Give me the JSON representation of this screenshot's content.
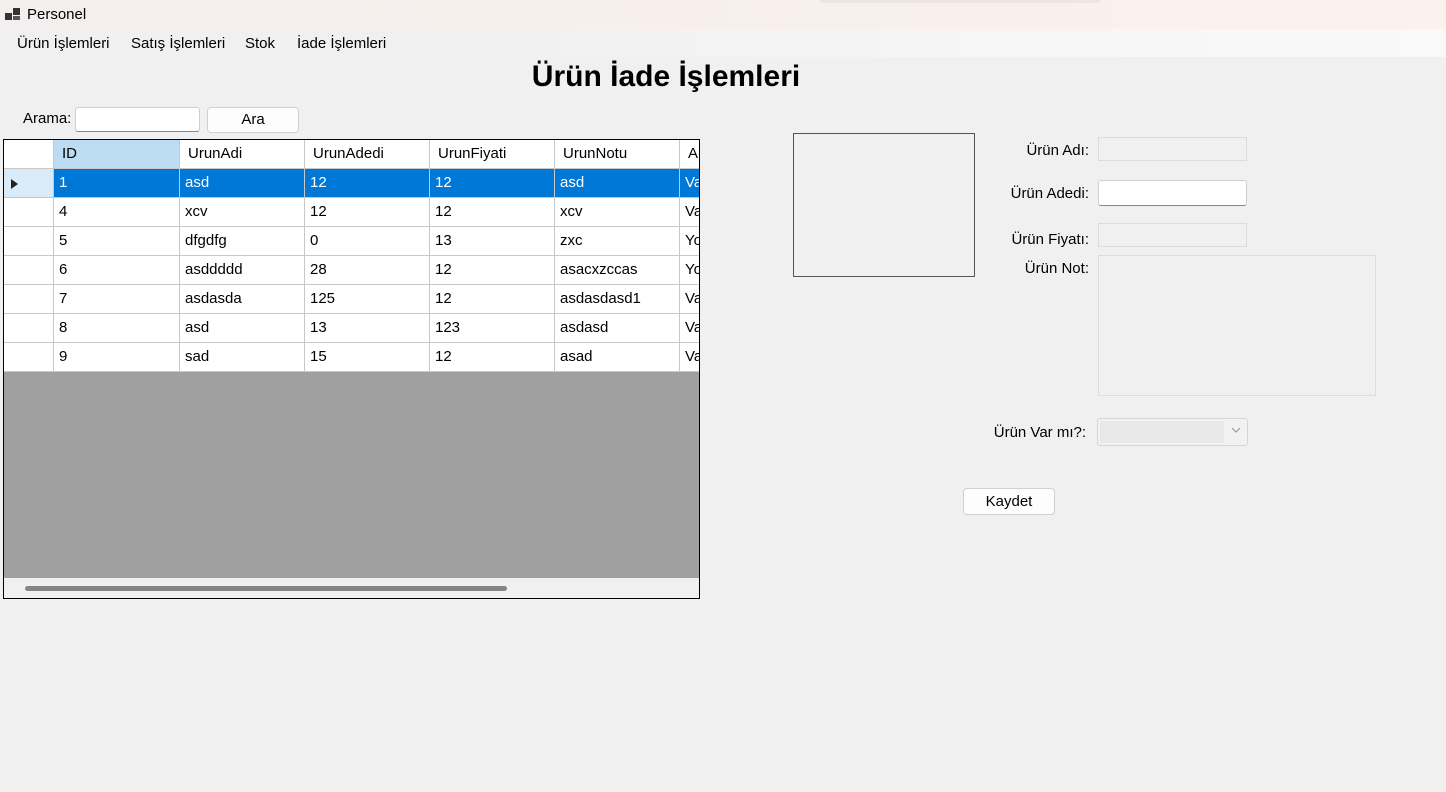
{
  "window": {
    "title": "Personel"
  },
  "menu": [
    {
      "label": "Ürün İşlemleri"
    },
    {
      "label": "Satış İşlemleri"
    },
    {
      "label": "Stok"
    },
    {
      "label": "İade İşlemleri"
    }
  ],
  "page_title": "Ürün İade İşlemleri",
  "search": {
    "label": "Arama:",
    "value": "",
    "button": "Ara"
  },
  "grid": {
    "columns": [
      "ID",
      "UrunAdi",
      "UrunAdedi",
      "UrunFiyati",
      "UrunNotu",
      "A"
    ],
    "rows": [
      [
        "1",
        "asd",
        "12",
        "12",
        "asd",
        "Va"
      ],
      [
        "4",
        "xcv",
        "12",
        "12",
        "xcv",
        "Va"
      ],
      [
        "5",
        "dfgdfg",
        "0",
        "13",
        "zxc",
        "Yo"
      ],
      [
        "6",
        "asddddd",
        "28",
        "12",
        "asacxzccas",
        "Yo"
      ],
      [
        "7",
        "asdasda",
        "125",
        "12",
        "asdasdasd1",
        "Va"
      ],
      [
        "8",
        "asd",
        "13",
        "123",
        "asdasd",
        "Va"
      ],
      [
        "9",
        "sad",
        "15",
        "12",
        "asad",
        "Va"
      ]
    ],
    "selected_row": 0
  },
  "form": {
    "urun_adi_label": "Ürün Adı:",
    "urun_adedi_label": "Ürün Adedi:",
    "urun_fiyati_label": "Ürün Fiyatı:",
    "urun_not_label": "Ürün Not:",
    "urun_var_mi_label": "Ürün Var mı?:",
    "urun_adi_value": "",
    "urun_adedi_value": "",
    "urun_fiyati_value": "",
    "urun_not_value": "",
    "urun_var_mi_value": "",
    "save_button": "Kaydet"
  },
  "colors": {
    "selection": "#0078d7",
    "header_active": "#bcdcf4",
    "grid_background": "#a0a0a0",
    "window_background": "#f0f0f0"
  },
  "icons": {
    "app": "app-windows-icon",
    "row_pointer": "row-pointer-icon",
    "dropdown": "chevron-down-icon"
  }
}
